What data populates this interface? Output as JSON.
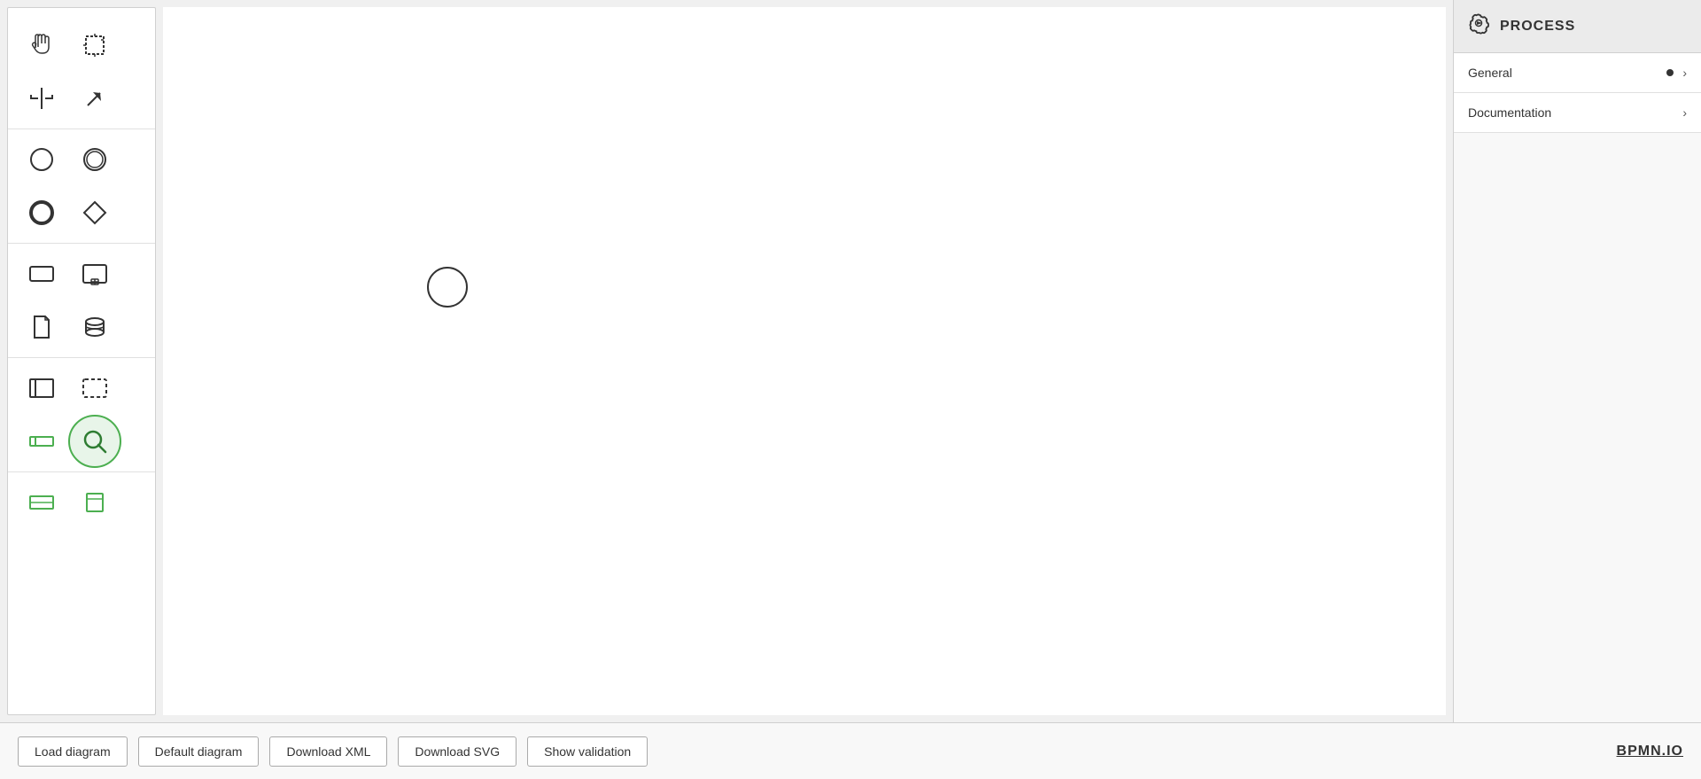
{
  "toolbar": {
    "tools": [
      {
        "name": "hand",
        "label": "Hand tool",
        "section": 0
      },
      {
        "name": "select",
        "label": "Select tool",
        "section": 0
      },
      {
        "name": "split",
        "label": "Split tool",
        "section": 0
      },
      {
        "name": "arrow",
        "label": "Arrow/Connect tool",
        "section": 0
      },
      {
        "name": "event-start",
        "label": "Start Event (circle)",
        "section": 1
      },
      {
        "name": "event-intermediate",
        "label": "Intermediate Event (double circle)",
        "section": 1
      },
      {
        "name": "event-end",
        "label": "End Event (bold circle)",
        "section": 1
      },
      {
        "name": "gateway",
        "label": "Gateway (diamond)",
        "section": 1
      },
      {
        "name": "task",
        "label": "Task (rectangle)",
        "section": 2
      },
      {
        "name": "subprocess",
        "label": "Sub-process (rect with icon)",
        "section": 2
      },
      {
        "name": "data-object",
        "label": "Data Object (document)",
        "section": 2
      },
      {
        "name": "data-store",
        "label": "Data Store (cylinder)",
        "section": 2
      },
      {
        "name": "pool",
        "label": "Pool (frame)",
        "section": 3
      },
      {
        "name": "group",
        "label": "Group (dashed rect)",
        "section": 3
      },
      {
        "name": "collapsed-pool",
        "label": "Collapsed Pool",
        "section": 3
      },
      {
        "name": "find",
        "label": "Find (magnifier)",
        "section": 3,
        "active": true
      },
      {
        "name": "lane-h",
        "label": "Horizontal Lane",
        "section": 4
      },
      {
        "name": "lane-v",
        "label": "Vertical Lane",
        "section": 4
      }
    ]
  },
  "panel": {
    "header": {
      "title": "PROCESS",
      "icon": "gear-play-icon"
    },
    "items": [
      {
        "label": "General",
        "has_dot": true,
        "has_chevron": true
      },
      {
        "label": "Documentation",
        "has_dot": false,
        "has_chevron": true
      }
    ]
  },
  "bottom_bar": {
    "buttons": [
      {
        "label": "Load diagram",
        "name": "load-diagram-button"
      },
      {
        "label": "Default diagram",
        "name": "default-diagram-button"
      },
      {
        "label": "Download XML",
        "name": "download-xml-button"
      },
      {
        "label": "Download SVG",
        "name": "download-svg-button"
      },
      {
        "label": "Show validation",
        "name": "show-validation-button"
      }
    ],
    "logo": "BPMN.IO"
  },
  "canvas": {
    "element": {
      "type": "start-event-circle",
      "label": "Start Event"
    }
  }
}
